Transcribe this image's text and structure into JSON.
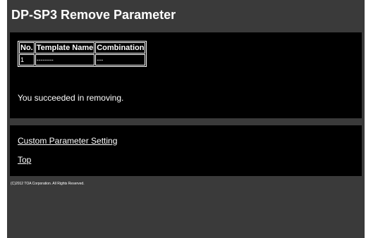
{
  "page": {
    "title": "DP-SP3 Remove Parameter"
  },
  "table": {
    "headers": [
      "No.",
      "Template Name",
      "Combination"
    ],
    "rows": [
      [
        "1",
        "--------",
        "---"
      ]
    ]
  },
  "status_message": "You succeeded in removing.",
  "links": {
    "custom_parameter_setting": "Custom Parameter Setting",
    "top": "Top"
  },
  "footer": {
    "copyright": "(C)2012 TOA Corporation. All Rights Reserved."
  },
  "colors": {
    "page_background": "#3a3a3a",
    "panel_background": "#000000",
    "text": "#ffffff"
  }
}
